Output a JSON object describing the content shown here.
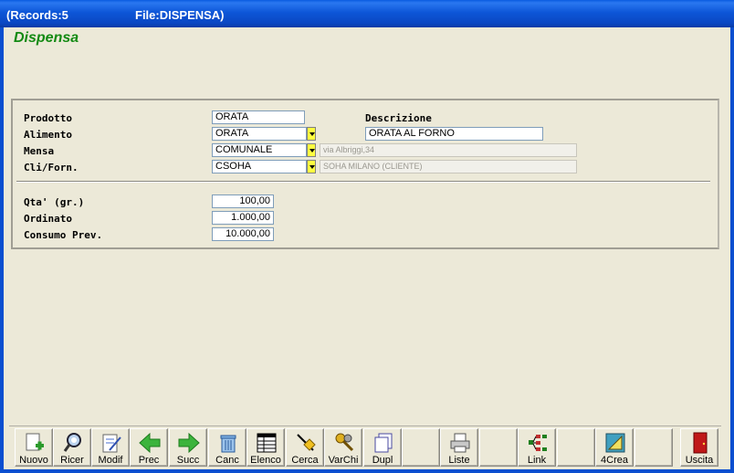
{
  "titlebar": {
    "records": "(Records:5",
    "file": "File:DISPENSA)"
  },
  "form": {
    "heading": "Dispensa",
    "labels": {
      "prodotto": "Prodotto",
      "alimento": "Alimento",
      "mensa": "Mensa",
      "cli_forn": "Cli/Forn.",
      "descrizione": "Descrizione",
      "qta": "Qta' (gr.)",
      "ordinato": "Ordinato",
      "consumo": "Consumo Prev."
    },
    "values": {
      "prodotto": "ORATA",
      "alimento": "ORATA",
      "descrizione": "ORATA AL FORNO",
      "mensa": "COMUNALE",
      "mensa_info": "via Albriggi,34",
      "cli_forn": "CSOHA",
      "cli_forn_info": "SOHA MILANO (CLIENTE)",
      "qta": "100,00",
      "ordinato": "1.000,00",
      "consumo": "10.000,00"
    }
  },
  "toolbar": [
    {
      "label": "Nuovo",
      "icon": "new-icon"
    },
    {
      "label": "Ricer",
      "icon": "search-icon"
    },
    {
      "label": "Modif",
      "icon": "edit-icon"
    },
    {
      "label": "Prec",
      "icon": "arrow-left-icon"
    },
    {
      "label": "Succ",
      "icon": "arrow-right-icon"
    },
    {
      "label": "Canc",
      "icon": "trash-icon"
    },
    {
      "label": "Elenco",
      "icon": "list-icon"
    },
    {
      "label": "Cerca",
      "icon": "find-icon"
    },
    {
      "label": "VarChi",
      "icon": "keys-icon"
    },
    {
      "label": "Dupl",
      "icon": "duplicate-icon"
    },
    {
      "label": "",
      "icon": ""
    },
    {
      "label": "Liste",
      "icon": "printer-icon"
    },
    {
      "label": "",
      "icon": ""
    },
    {
      "label": "Link",
      "icon": "link-icon"
    },
    {
      "label": "",
      "icon": ""
    },
    {
      "label": "4Crea",
      "icon": "create-icon"
    },
    {
      "label": "",
      "icon": ""
    },
    {
      "label": "Uscita",
      "icon": "exit-door-icon"
    }
  ],
  "colors": {
    "heading": "#138a13",
    "titlebar": "#0a47c2",
    "dropdown": "#ffff40"
  }
}
